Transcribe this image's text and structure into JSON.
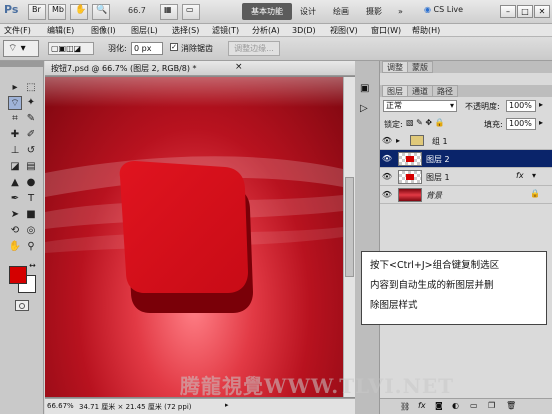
{
  "appbar": {
    "logo": "Ps",
    "zoom": "66.7",
    "workspaces": [
      "基本功能",
      "设计",
      "绘画",
      "摄影"
    ],
    "more": "»",
    "cs_live": "CS Live"
  },
  "menu": [
    "文件(F)",
    "编辑(E)",
    "图像(I)",
    "图层(L)",
    "选择(S)",
    "滤镜(T)",
    "分析(A)",
    "3D(D)",
    "视图(V)",
    "窗口(W)",
    "帮助(H)"
  ],
  "options": {
    "feather_label": "羽化:",
    "feather_value": "0 px",
    "antialias_label": "消除锯齿",
    "refine_edge": "调整边缘..."
  },
  "document": {
    "tab_title": "按钮7.psd @ 66.7% (图层 2, RGB/8) *",
    "zoom": "66.67%",
    "doc_info": "34.71 厘米 × 21.45 厘米 (72 ppi)"
  },
  "panels": {
    "top_tabs": [
      "调整",
      "蒙版"
    ],
    "layer_tabs": [
      "图层",
      "通道",
      "路径"
    ],
    "blend_mode": "正常",
    "opacity_label": "不透明度:",
    "opacity_value": "100%",
    "lock_label": "锁定:",
    "fill_label": "填充:",
    "fill_value": "100%",
    "layers": [
      {
        "name": "组 1",
        "type": "group"
      },
      {
        "name": "图层 2",
        "type": "layer",
        "selected": true
      },
      {
        "name": "图层 1",
        "type": "layer",
        "fx": "fx"
      },
      {
        "name": "背景",
        "type": "background"
      }
    ]
  },
  "callout": {
    "line1": "按下<Ctrl+J>组合键复制选区",
    "line2": "内容到自动生成的新图层并删",
    "line3": "除图层样式"
  },
  "watermark": "腾龍視覺WWW.TLVI.NET",
  "colors": {
    "foreground": "#d40000",
    "background": "#ffffff",
    "selected_layer": "#0a246a",
    "canvas_red": "#c8121f"
  }
}
